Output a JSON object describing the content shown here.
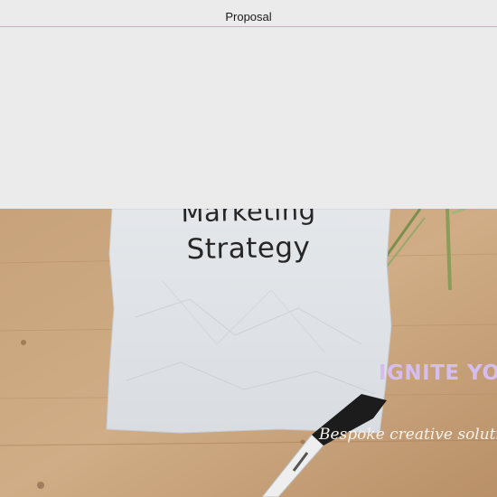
{
  "header": {
    "title": "Proposal"
  },
  "hero": {
    "image_description_icon": "photo",
    "paper_line1": "Marketing",
    "paper_line2": "Strategy",
    "headline": "IGNITE YO",
    "tagline": "Bespoke creative soluti",
    "colors": {
      "headline": "#d6bdf0",
      "tagline": "#f7f2ea",
      "accent_line": "#8fcfc0"
    }
  }
}
